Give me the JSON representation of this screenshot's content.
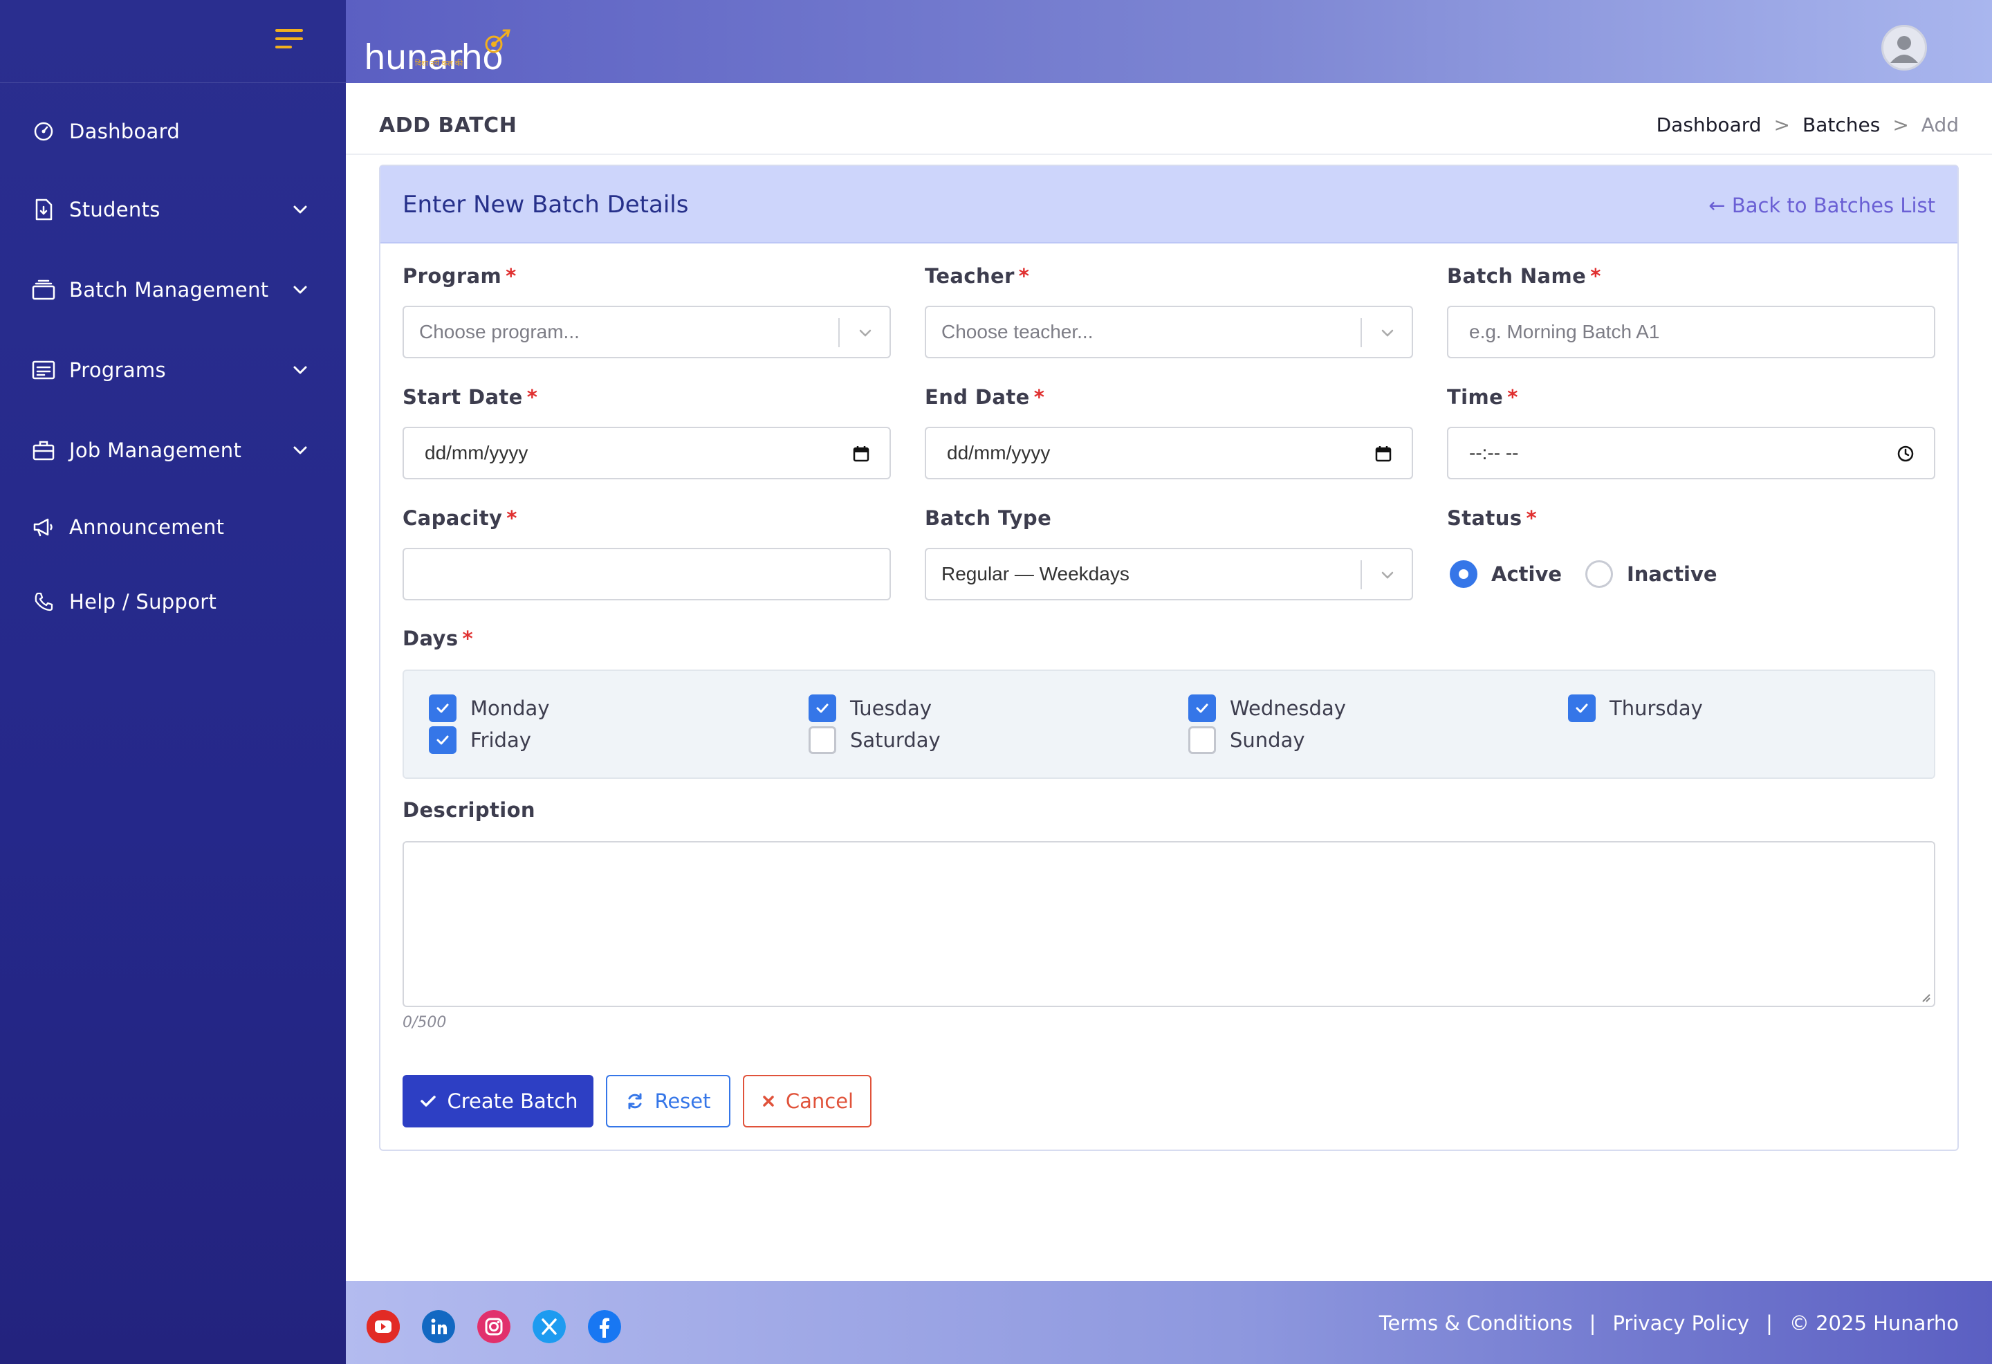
{
  "brand": {
    "name": "hunarho",
    "tagline": "दिशा नये कल की",
    "accent": "#f2b01e",
    "sidebar_bg": "#2a2e8f",
    "primary": "#2d3fc4"
  },
  "sidebar": {
    "items": [
      {
        "label": "Dashboard",
        "icon": "gauge-icon",
        "expandable": false
      },
      {
        "label": "Students",
        "icon": "student-file-icon",
        "expandable": true
      },
      {
        "label": "Batch Management",
        "icon": "layers-icon",
        "expandable": true
      },
      {
        "label": "Programs",
        "icon": "list-icon",
        "expandable": true
      },
      {
        "label": "Job Management",
        "icon": "briefcase-icon",
        "expandable": true
      },
      {
        "label": "Announcement",
        "icon": "megaphone-icon",
        "expandable": false
      },
      {
        "label": "Help / Support",
        "icon": "phone-icon",
        "expandable": false
      }
    ]
  },
  "page": {
    "title": "ADD BATCH",
    "breadcrumb": [
      "Dashboard",
      "Batches",
      "Add"
    ],
    "breadcrumb_sep": ">"
  },
  "form": {
    "heading": "Enter New Batch Details",
    "back_link": "← Back to Batches List",
    "required_mark": "*",
    "program": {
      "label": "Program",
      "placeholder": "Choose program..."
    },
    "teacher": {
      "label": "Teacher",
      "placeholder": "Choose teacher..."
    },
    "batch_name": {
      "label": "Batch Name",
      "placeholder": "e.g. Morning Batch A1"
    },
    "start_date": {
      "label": "Start Date",
      "value": "dd/mm/yyyy"
    },
    "end_date": {
      "label": "End Date",
      "value": "dd/mm/yyyy"
    },
    "time": {
      "label": "Time",
      "value": "--:-- --"
    },
    "capacity": {
      "label": "Capacity",
      "value": ""
    },
    "batch_type": {
      "label": "Batch Type",
      "value": "Regular — Weekdays"
    },
    "status": {
      "label": "Status",
      "options": [
        {
          "label": "Active",
          "selected": true
        },
        {
          "label": "Inactive",
          "selected": false
        }
      ]
    },
    "days": {
      "label": "Days",
      "items": [
        {
          "label": "Monday",
          "checked": true
        },
        {
          "label": "Tuesday",
          "checked": true
        },
        {
          "label": "Wednesday",
          "checked": true
        },
        {
          "label": "Thursday",
          "checked": true
        },
        {
          "label": "Friday",
          "checked": true
        },
        {
          "label": "Saturday",
          "checked": false
        },
        {
          "label": "Sunday",
          "checked": false
        }
      ]
    },
    "description": {
      "label": "Description",
      "value": "",
      "counter": "0/500"
    },
    "buttons": {
      "create": "Create Batch",
      "reset": "Reset",
      "cancel": "Cancel"
    }
  },
  "footer": {
    "social": [
      "youtube-icon",
      "linkedin-icon",
      "instagram-icon",
      "x-icon",
      "facebook-icon"
    ],
    "links": [
      "Terms & Conditions",
      "Privacy Policy"
    ],
    "separator": "|",
    "copyright": "© 2025 Hunarho"
  }
}
